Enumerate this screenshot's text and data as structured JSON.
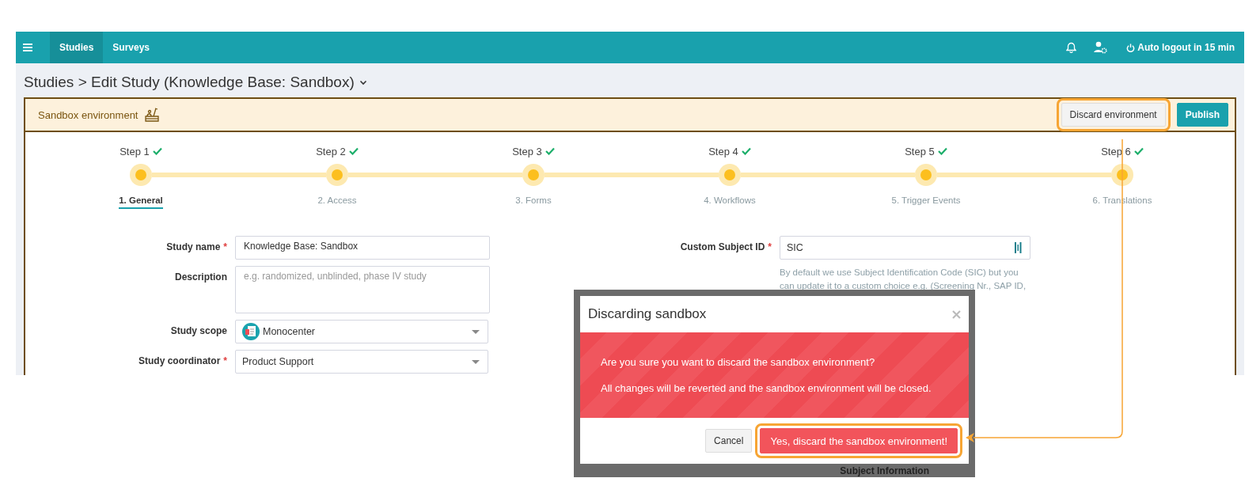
{
  "topbar": {
    "tabs": [
      {
        "label": "Studies",
        "selected": true
      },
      {
        "label": "Surveys",
        "selected": false
      }
    ],
    "logout": "Auto logout in 15 min"
  },
  "breadcrumb": "Studies > Edit Study (Knowledge Base: Sandbox)",
  "sandbox": {
    "label": "Sandbox environment",
    "buttons": [
      {
        "label": "Discard environment",
        "kind": "secondary",
        "highlighted": true
      },
      {
        "label": "Publish",
        "kind": "primary",
        "highlighted": false
      }
    ]
  },
  "steps": [
    {
      "title": "Step 1",
      "done": true,
      "label": "1. General",
      "selected": true
    },
    {
      "title": "Step 2",
      "done": true,
      "label": "2. Access",
      "selected": false
    },
    {
      "title": "Step 3",
      "done": true,
      "label": "3. Forms",
      "selected": false
    },
    {
      "title": "Step 4",
      "done": true,
      "label": "4. Workflows",
      "selected": false
    },
    {
      "title": "Step 5",
      "done": true,
      "label": "5. Trigger Events",
      "selected": false
    },
    {
      "title": "Step 6",
      "done": true,
      "label": "6. Translations",
      "selected": false
    }
  ],
  "form_left": [
    {
      "label": "Study name",
      "required_mark": "*",
      "kind": "text",
      "value": "Knowledge Base: Sandbox"
    },
    {
      "label": "Description",
      "kind": "textarea",
      "placeholder": "e.g. randomized, unblinded, phase IV study"
    },
    {
      "label": "Study scope",
      "kind": "select",
      "value": "Monocenter"
    },
    {
      "label": "Study coordinator",
      "required_mark": "*",
      "kind": "select",
      "value": "Product Support"
    }
  ],
  "form_right": {
    "label": "Custom Subject ID",
    "required_mark": "*",
    "value": "SIC",
    "help": "By default we use Subject Identification Code (SIC) but you can update it to a custom choice e.g. (Screening Nr., SAP ID,"
  },
  "dialog": {
    "title": "Discarding sandbox",
    "messages": [
      "Are you sure you want to discard the sandbox environment?",
      "All changes will be reverted and the sandbox environment will be closed."
    ],
    "buttons": [
      {
        "label": "Cancel",
        "kind": "secondary",
        "highlighted": false
      },
      {
        "label": "Yes, discard the sandbox environment!",
        "kind": "danger",
        "highlighted": true
      }
    ],
    "backdrop_text": "Subject Information"
  }
}
